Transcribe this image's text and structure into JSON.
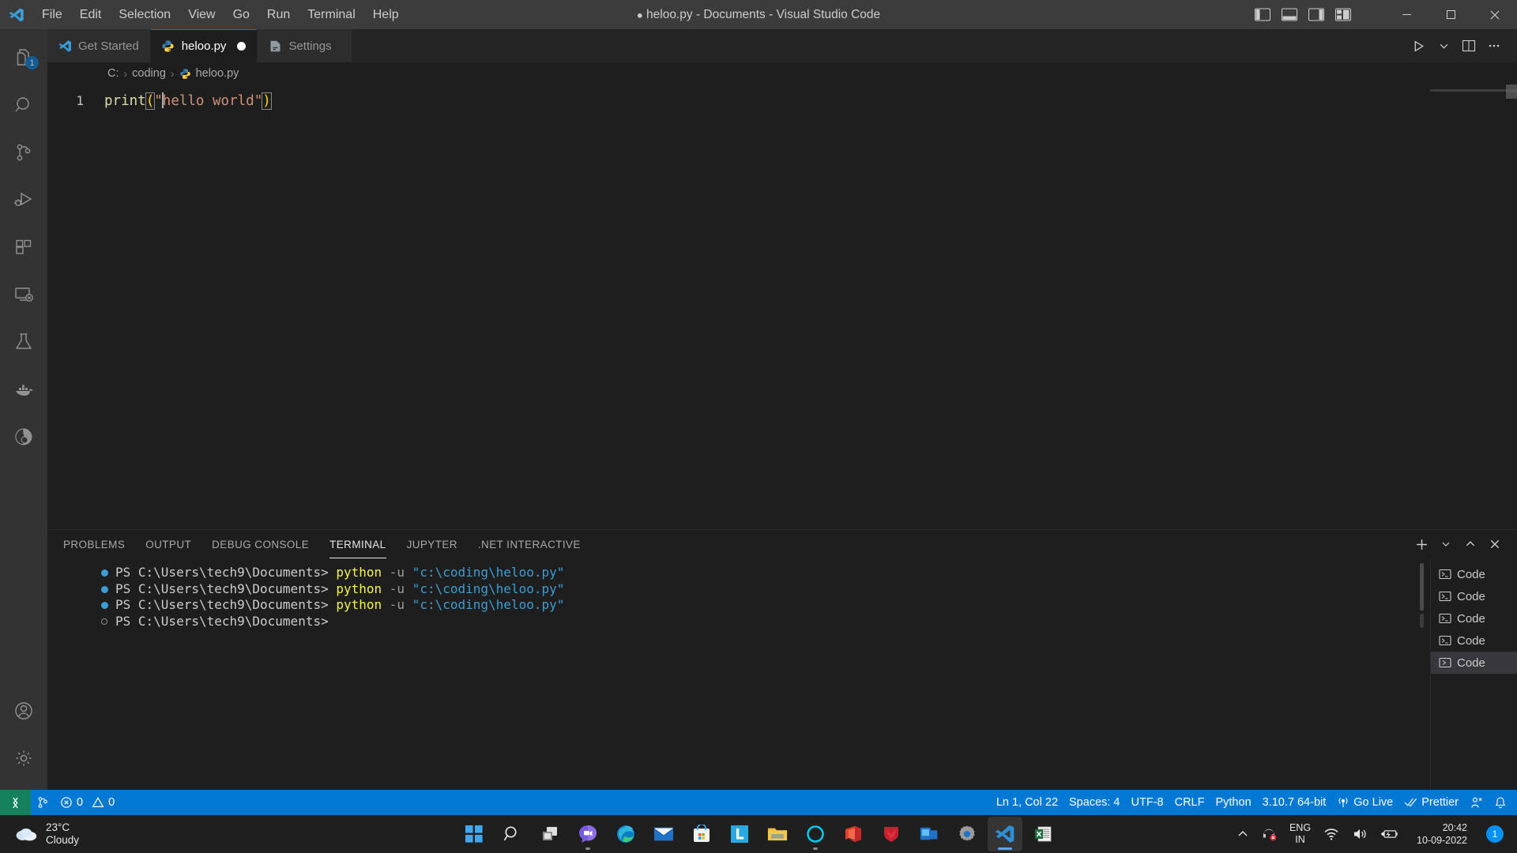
{
  "titlebar": {
    "logo_icon": "vscode-logo-icon",
    "menus": [
      "File",
      "Edit",
      "Selection",
      "View",
      "Go",
      "Run",
      "Terminal",
      "Help"
    ],
    "window_title": "heloo.py - Documents - Visual Studio Code",
    "dirty_indicator": "●",
    "layout_controls": [
      "toggle-primary-sidebar-icon",
      "toggle-panel-icon",
      "toggle-secondary-sidebar-icon",
      "customize-layout-icon"
    ],
    "window_buttons": {
      "minimize": "─",
      "maximize": "☐",
      "close": "✕"
    }
  },
  "activitybar": {
    "items": [
      {
        "name": "explorer",
        "icon": "files-icon",
        "badge": "1",
        "active": false
      },
      {
        "name": "search",
        "icon": "search-icon",
        "badge": "",
        "active": false
      },
      {
        "name": "source-control",
        "icon": "source-control-icon",
        "badge": "",
        "active": false
      },
      {
        "name": "run-and-debug",
        "icon": "run-and-debug-icon",
        "badge": "",
        "active": false
      },
      {
        "name": "extensions",
        "icon": "extensions-icon",
        "badge": "",
        "active": false
      },
      {
        "name": "remote-explorer",
        "icon": "remote-explorer-icon",
        "badge": "",
        "active": false
      },
      {
        "name": "testing",
        "icon": "beaker-icon",
        "badge": "",
        "active": false
      },
      {
        "name": "docker",
        "icon": "docker-whale-icon",
        "badge": "",
        "active": false
      },
      {
        "name": "anaconda",
        "icon": "anaconda-icon",
        "badge": "",
        "active": false
      }
    ],
    "bottom": [
      {
        "name": "accounts",
        "icon": "account-icon"
      },
      {
        "name": "manage-settings",
        "icon": "gear-icon"
      }
    ]
  },
  "tabs": [
    {
      "label": "Get Started",
      "icon": "vscode-logo-icon",
      "active": false,
      "dirty": false
    },
    {
      "label": "heloo.py",
      "icon": "python-file-icon",
      "active": true,
      "dirty": true
    },
    {
      "label": "Settings",
      "icon": "settings-file-icon",
      "active": false,
      "dirty": false
    }
  ],
  "editor_actions": {
    "run_label": "▷",
    "run_dropdown_label": "⌄",
    "split_editor_label": "split-editor",
    "more_actions_label": "⋯"
  },
  "breadcrumb": {
    "items": [
      "C:",
      "coding",
      "heloo.py"
    ],
    "separator": "›",
    "file_icon": "python-file-icon"
  },
  "editor": {
    "line_number": "1",
    "code": {
      "fn": "print",
      "open_paren": "(",
      "quote_open": "\"",
      "string_before_caret": "",
      "string_after_caret": "hello world",
      "quote_close": "\"",
      "close_paren": ")"
    }
  },
  "panel": {
    "tabs": [
      "PROBLEMS",
      "OUTPUT",
      "DEBUG CONSOLE",
      "TERMINAL",
      "JUPYTER",
      ".NET INTERACTIVE"
    ],
    "active_tab": "TERMINAL",
    "actions": {
      "new_terminal": "+",
      "new_terminal_dropdown": "⌄",
      "maximize_panel": "⌃",
      "close_panel": "✕"
    },
    "terminal_lines": [
      {
        "status": "success",
        "prompt": "PS C:\\Users\\tech9\\Documents>",
        "command": "python",
        "flag": "-u",
        "arg": "\"c:\\coding\\heloo.py\""
      },
      {
        "status": "success",
        "prompt": "PS C:\\Users\\tech9\\Documents>",
        "command": "python",
        "flag": "-u",
        "arg": "\"c:\\coding\\heloo.py\""
      },
      {
        "status": "success",
        "prompt": "PS C:\\Users\\tech9\\Documents>",
        "command": "python",
        "flag": "-u",
        "arg": "\"c:\\coding\\heloo.py\""
      },
      {
        "status": "idle",
        "prompt": "PS C:\\Users\\tech9\\Documents>",
        "command": "",
        "flag": "",
        "arg": ""
      }
    ],
    "terminal_list": [
      {
        "label": "Code",
        "icon": "terminal-powershell-icon",
        "active": false
      },
      {
        "label": "Code",
        "icon": "terminal-powershell-icon",
        "active": false
      },
      {
        "label": "Code",
        "icon": "terminal-powershell-icon",
        "active": false
      },
      {
        "label": "Code",
        "icon": "terminal-powershell-icon",
        "active": false
      },
      {
        "label": "Code",
        "icon": "terminal-cmd-icon",
        "active": true
      }
    ]
  },
  "statusbar": {
    "remote_icon": "remote-window-icon",
    "branch_icon": "source-control-icon",
    "errors_icon": "error-icon",
    "errors_count": "0",
    "warnings_icon": "warning-icon",
    "warnings_count": "0",
    "cursor_position": "Ln 1, Col 22",
    "indentation": "Spaces: 4",
    "encoding": "UTF-8",
    "eol": "CRLF",
    "language": "Python",
    "interpreter": "3.10.7 64-bit",
    "go_live": "Go Live",
    "go_live_icon": "broadcast-icon",
    "prettier": "Prettier",
    "prettier_icon": "checkmarks-icon",
    "feedback_icon": "feedback-icon",
    "bell_icon": "bell-icon",
    "accent_color": "#0078d4",
    "remote_color": "#16825d"
  },
  "taskbar": {
    "weather": {
      "temperature": "23°C",
      "condition": "Cloudy",
      "icon": "cloud-icon"
    },
    "icons": [
      {
        "name": "start-button",
        "icon": "windows-start-icon",
        "state": ""
      },
      {
        "name": "search-button",
        "icon": "search-icon",
        "state": ""
      },
      {
        "name": "task-view-button",
        "icon": "task-view-icon",
        "state": ""
      },
      {
        "name": "chat-button",
        "icon": "teams-chat-icon",
        "state": "running"
      },
      {
        "name": "edge-button",
        "icon": "edge-icon",
        "state": ""
      },
      {
        "name": "mail-button",
        "icon": "mail-icon",
        "state": ""
      },
      {
        "name": "microsoft-store-button",
        "icon": "store-icon",
        "state": ""
      },
      {
        "name": "linkedin-button",
        "icon": "linkedin-icon",
        "state": ""
      },
      {
        "name": "file-explorer-button",
        "icon": "folder-icon",
        "state": ""
      },
      {
        "name": "alexa-button",
        "icon": "alexa-icon",
        "state": "running"
      },
      {
        "name": "office-button",
        "icon": "office-icon",
        "state": ""
      },
      {
        "name": "mcafee-button",
        "icon": "mcafee-shield-icon",
        "state": ""
      },
      {
        "name": "phone-link-button",
        "icon": "phone-link-icon",
        "state": ""
      },
      {
        "name": "settings-button",
        "icon": "gear-icon",
        "state": ""
      },
      {
        "name": "vscode-button",
        "icon": "vscode-logo-icon",
        "state": "active"
      },
      {
        "name": "excel-button",
        "icon": "excel-icon",
        "state": ""
      }
    ],
    "tray": {
      "chevron_icon": "chevron-up-icon",
      "mute_icon": "headset-muted-icon",
      "language_line1": "ENG",
      "language_line2": "IN",
      "wifi_icon": "wifi-icon",
      "volume_icon": "volume-icon",
      "battery_icon": "battery-saver-icon",
      "time": "20:42",
      "date": "10-09-2022",
      "notification_count": "1"
    }
  }
}
